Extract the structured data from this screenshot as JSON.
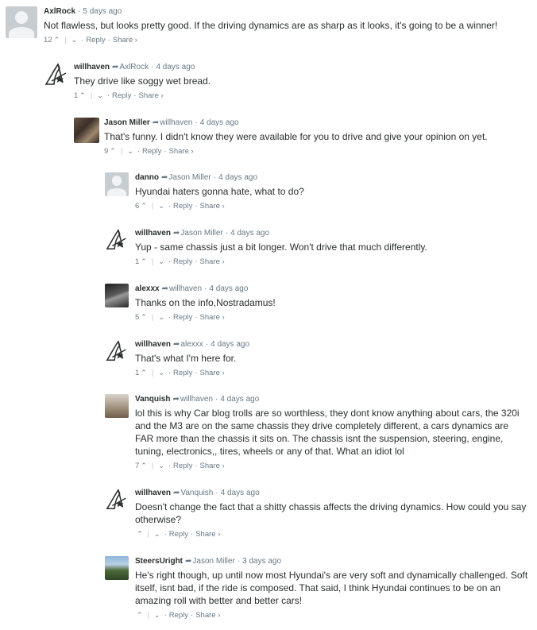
{
  "ui": {
    "reply_label": "Reply",
    "share_label": "Share ›",
    "vote_up": "^",
    "vote_down": "v",
    "reply_arrow": "➦"
  },
  "comments": [
    {
      "author": "AxlRock",
      "parent": "",
      "time": "5 days ago",
      "text": "Not flawless, but looks pretty good. If the driving dynamics are as sharp as it looks, it's going to be a winner!",
      "votes": "12",
      "avatar": "default-avatar"
    },
    {
      "author": "willhaven",
      "parent": "AxlRock",
      "time": "4 days ago",
      "text": "They drive like soggy wet bread.",
      "votes": "1",
      "avatar": "logo-avatar"
    },
    {
      "author": "Jason Miller",
      "parent": "willhaven",
      "time": "4 days ago",
      "text": "That's funny. I didn't know they were available for you to drive and give your opinion on yet.",
      "votes": "9",
      "avatar": "photo-avatar"
    },
    {
      "author": "danno",
      "parent": "Jason Miller",
      "time": "4 days ago",
      "text": "Hyundai haters gonna hate, what to do?",
      "votes": "6",
      "avatar": "default-avatar"
    },
    {
      "author": "willhaven",
      "parent": "Jason Miller",
      "time": "4 days ago",
      "text": "Yup - same chassis just a bit longer. Won't drive that much differently.",
      "votes": "1",
      "avatar": "logo-avatar"
    },
    {
      "author": "alexxx",
      "parent": "willhaven",
      "time": "4 days ago",
      "text": "Thanks on the info,Nostradamus!",
      "votes": "5",
      "avatar": "photo-avatar"
    },
    {
      "author": "willhaven",
      "parent": "alexxx",
      "time": "4 days ago",
      "text": "That's what I'm here for.",
      "votes": "1",
      "avatar": "logo-avatar"
    },
    {
      "author": "Vanquish",
      "parent": "willhaven",
      "time": "4 days ago",
      "text": "lol this is why Car blog trolls are so worthless, they dont know anything about cars, the 320i and the M3 are on the same chassis they drive completely different, a cars dynamics are FAR more than the chassis it sits on. The chassis isnt the suspension, steering, engine, tuning, electronics,, tires, wheels or any of that. What an idiot lol",
      "votes": "7",
      "avatar": "photo-avatar"
    },
    {
      "author": "willhaven",
      "parent": "Vanquish",
      "time": "4 days ago",
      "text": "Doesn't change the fact that a shitty chassis affects the driving dynamics. How could you say otherwise?",
      "votes": "",
      "avatar": "logo-avatar"
    },
    {
      "author": "SteersUright",
      "parent": "Jason Miller",
      "time": "3 days ago",
      "text": "He's right though, up until now most Hyundai's are very soft and dynamically challenged. Soft itself, isnt bad, if the ride is composed. That said, I think Hyundai continues to be on an amazing roll with better and better cars!",
      "votes": "",
      "avatar": "photo-avatar"
    }
  ]
}
